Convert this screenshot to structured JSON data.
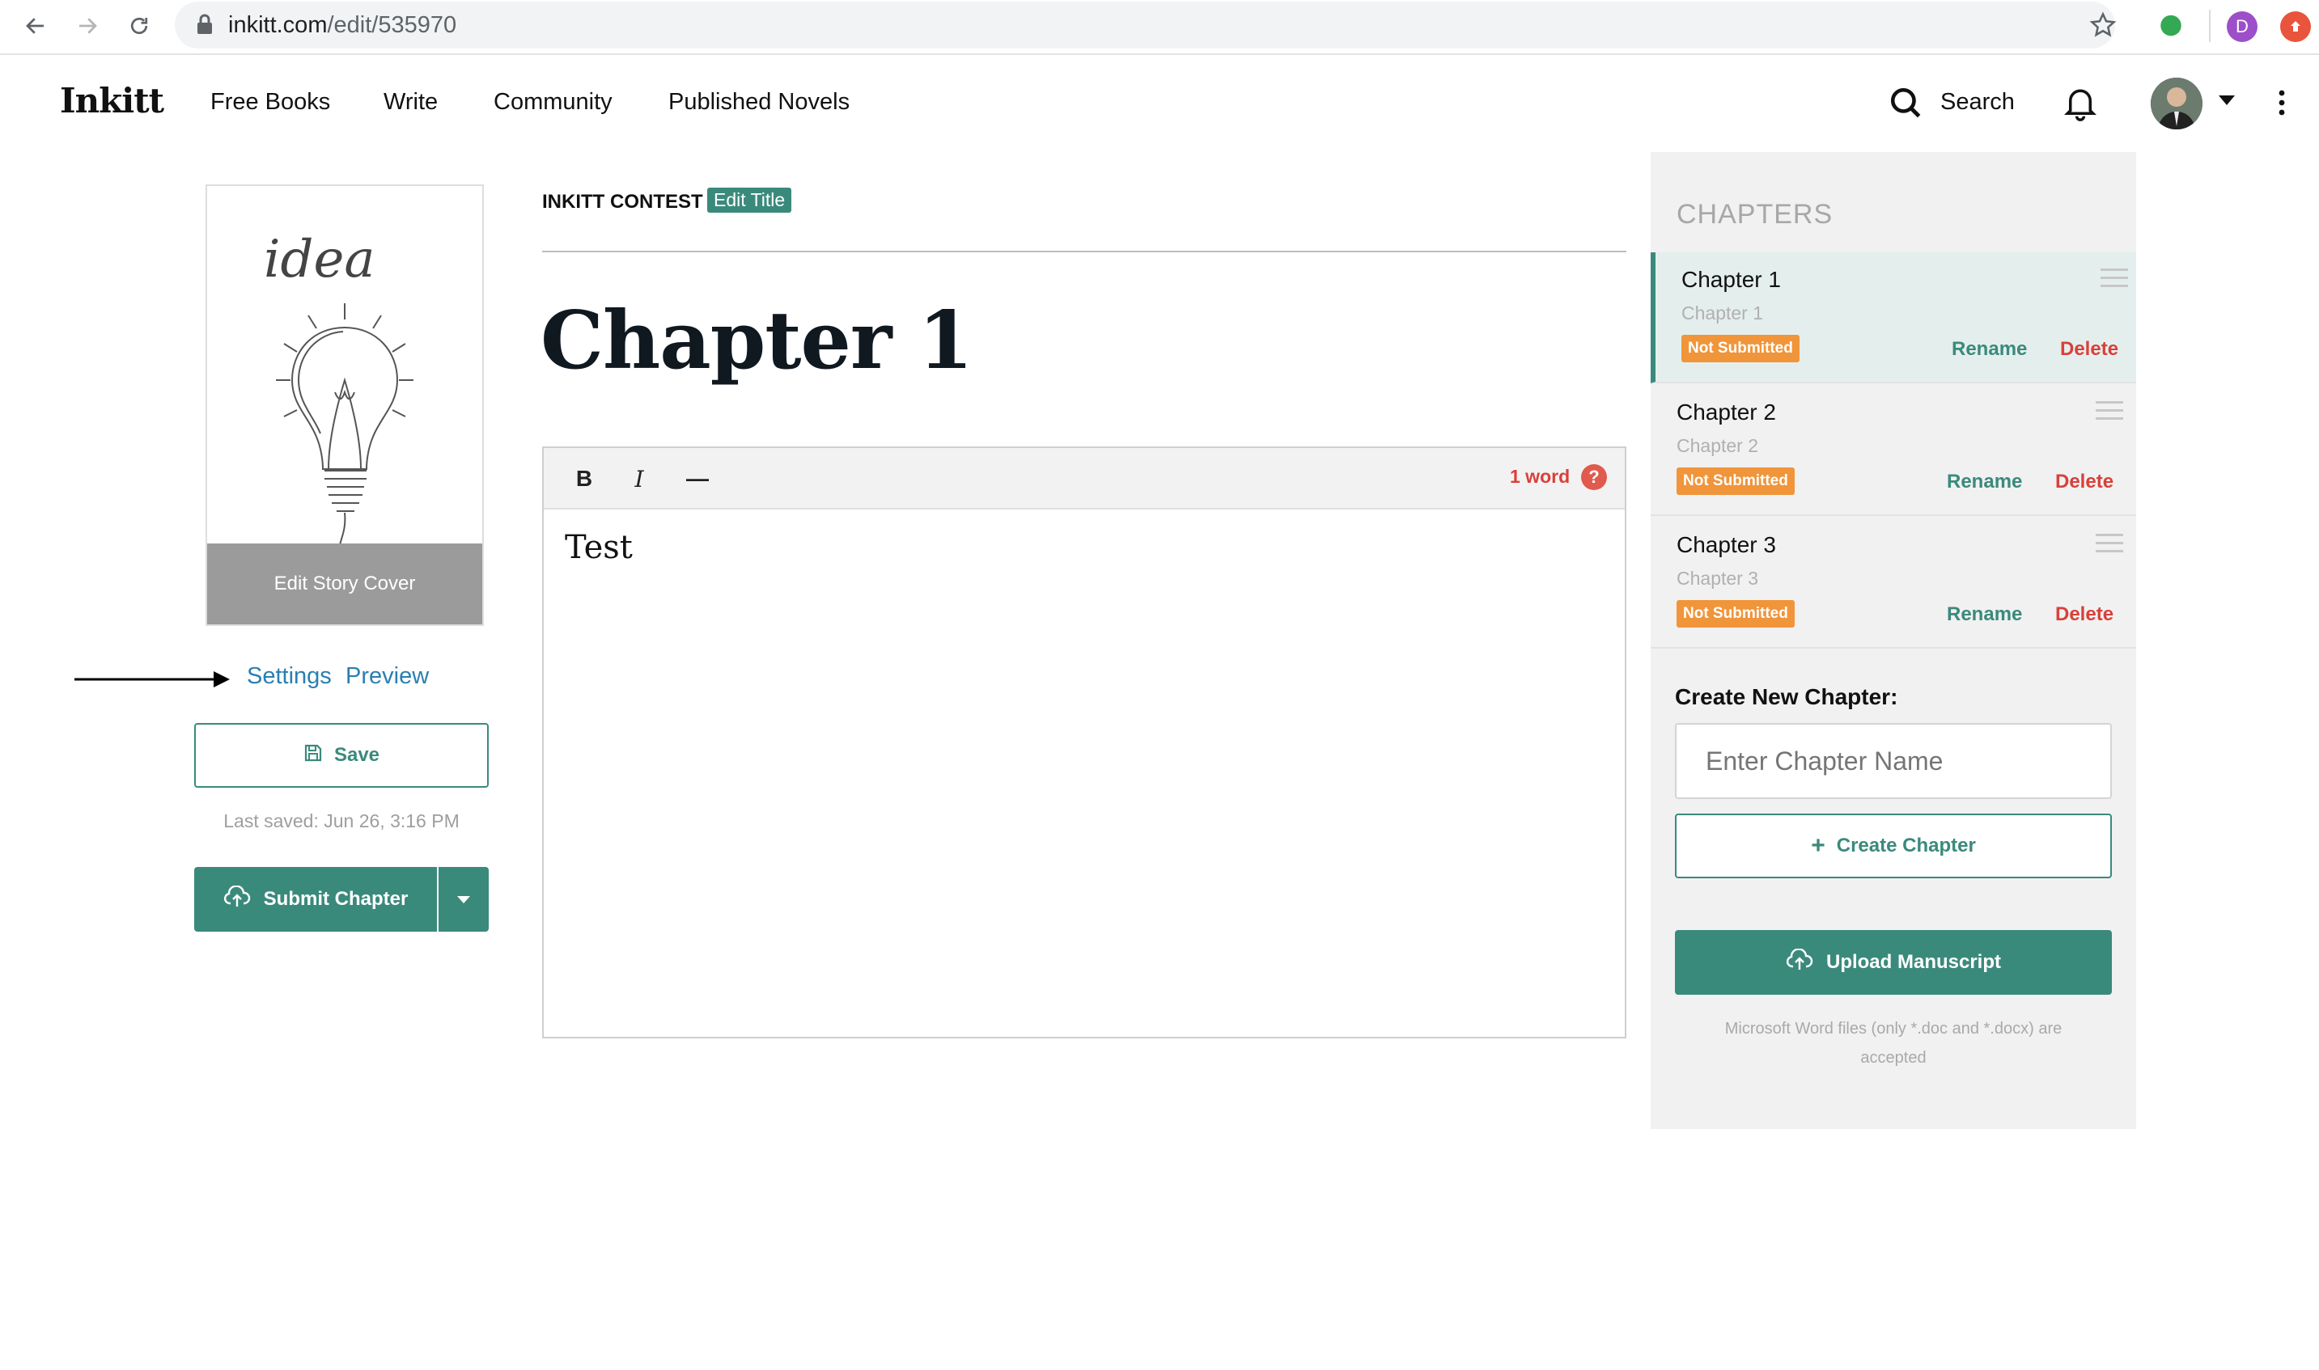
{
  "browser": {
    "url_host": "inkitt.com",
    "url_path": "/edit/535970",
    "profile_initial": "D"
  },
  "nav": {
    "logo": "Inkitt",
    "links": [
      "Free Books",
      "Write",
      "Community",
      "Published Novels"
    ],
    "search_label": "Search"
  },
  "left": {
    "cover_label": "Edit Story Cover",
    "cover_art_text": "idea",
    "settings_label": "Settings",
    "preview_label": "Preview",
    "save_label": "Save",
    "last_saved": "Last saved: Jun 26, 3:16 PM",
    "submit_label": "Submit Chapter"
  },
  "main": {
    "story_title": "INKITT CONTEST",
    "edit_title_label": "Edit Title",
    "chapter_heading": "Chapter 1",
    "toolbar": {
      "bold": "B",
      "italic": "I",
      "rule": "—",
      "word_count": "1 word",
      "help": "?"
    },
    "content": "Test"
  },
  "chapters_panel": {
    "heading": "CHAPTERS",
    "items": [
      {
        "title": "Chapter 1",
        "subtitle": "Chapter 1",
        "status": "Not Submitted",
        "rename": "Rename",
        "delete": "Delete",
        "active": true
      },
      {
        "title": "Chapter 2",
        "subtitle": "Chapter 2",
        "status": "Not Submitted",
        "rename": "Rename",
        "delete": "Delete",
        "active": false
      },
      {
        "title": "Chapter 3",
        "subtitle": "Chapter 3",
        "status": "Not Submitted",
        "rename": "Rename",
        "delete": "Delete",
        "active": false
      }
    ],
    "create_label": "Create New Chapter:",
    "input_placeholder": "Enter Chapter Name",
    "create_button": "Create Chapter",
    "upload_button": "Upload Manuscript",
    "upload_note": "Microsoft Word files (only *.doc and *.docx) are accepted"
  },
  "colors": {
    "accent": "#3a8a7c",
    "badge": "#f0953a",
    "delete": "#d9403a",
    "link": "#2a7fb0"
  }
}
